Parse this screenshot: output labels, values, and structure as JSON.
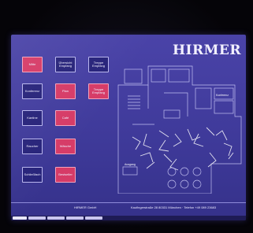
{
  "brand": {
    "logo_text": "HIRMER"
  },
  "tiles_col1": [
    {
      "label": "Mitte",
      "accent": "#d63b67"
    },
    {
      "label": "Konferenz",
      "accent": "#27237a"
    },
    {
      "label": "Kantine",
      "accent": "#27237a"
    },
    {
      "label": "Raucher",
      "accent": "#27237a"
    },
    {
      "label": "Schließfach",
      "accent": "#27237a"
    }
  ],
  "tiles_col2": [
    {
      "label": "Übersicht Empfang",
      "accent": "#27237a"
    },
    {
      "label": "Plan",
      "accent": "#d63b67"
    },
    {
      "label": "Café",
      "accent": "#d63b67"
    },
    {
      "label": "Wäsche",
      "accent": "#d63b67"
    },
    {
      "label": "Bestseller",
      "accent": "#d63b67"
    }
  ],
  "tiles_col3": [
    {
      "label": "Treppe Empfang",
      "accent": "#27237a"
    },
    {
      "label": "Treppe Empfang",
      "accent": "#d63b67"
    }
  ],
  "plan_labels": {
    "room_top": "Konferenz",
    "room_left": "Ausgang"
  },
  "footer": {
    "company": "HIRMER GmbH",
    "address": "Kaufingerstraße 28 80331 München · Telefon +49 089 23683"
  },
  "taskbar": {
    "start_label": "Start"
  },
  "colors": {
    "screen": "#4a43a8",
    "tile_blue": "#27237a",
    "tile_pink": "#d63b67",
    "text": "#f0eeff"
  }
}
